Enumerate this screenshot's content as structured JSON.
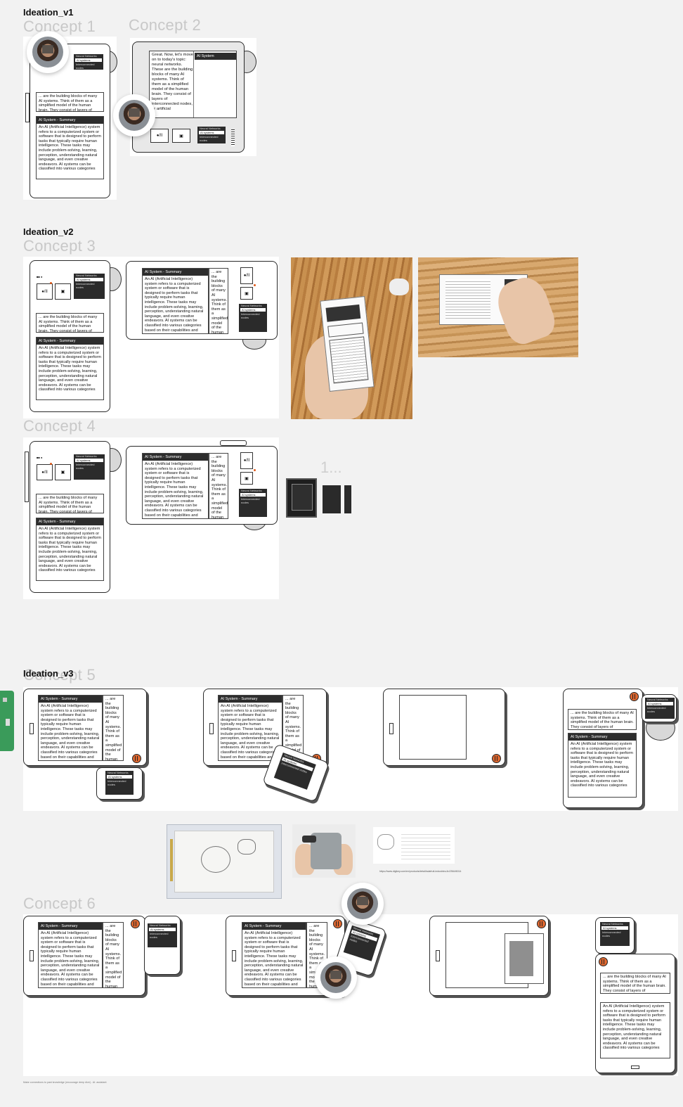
{
  "sections": {
    "v1": "Ideation_v1",
    "v2": "Ideation_v2",
    "v3": "Ideation_v3"
  },
  "concepts": {
    "c1": "Concept 1",
    "c2": "Concept 2",
    "c3": "Concept 3",
    "c4": "Concept 4",
    "c5": "Concept 5",
    "c6": "Concept 6"
  },
  "ui": {
    "reading_snippet": "... are the building blocks of many AI systems. Think of them as a simplified model of the human brain. They consist of layers of",
    "reading_col": "... are the building blocks of many AI systems. Think of them as a simplified model of the human brain. They consist of",
    "summary_title": "AI System - Summary",
    "summary_body": "An AI (Artificial Intelligence) system refers to a computerized system or software that is designed to perform tasks that typically require human intelligence. These tasks may include problem-solving, learning, perception, understanding natural language, and even creative endeavors. AI systems can be classified into various categories",
    "summary_body_long": "An AI (Artificial Intelligence) system refers to a computerized system or software that is designed to perform tasks that typically require human intelligence. These tasks may include problem-solving, learning, perception, understanding natural language, and even creative endeavors. AI systems can be classified into various categories based on their capabilities and",
    "concept2_text": "Great. Now, let's move on to today's topic: neural networks. These are the building blocks of many AI systems. Think of them as a simplified model of the human brain. They consist of layers of interconnected nodes, or artificial",
    "concept2_header": "AI System",
    "neural_title": "Neural Networks",
    "neural_item1": "AI systems",
    "neural_item2": "Interconnected nodes",
    "play_label": "●/II",
    "grid_label": "▣",
    "placeholder_count": "1...",
    "url_text": "https://www.digikey.com/en/products/detail/adafruit-industries-llc/2564/6014",
    "footnote": "Make connections to past knowledge (encourage deep dive) - AI: assistant"
  },
  "colors": {
    "accent": "#e06830",
    "frame": "#2a2a2a",
    "concept_label": "#c8c8c8",
    "canvas": "#f2f2f2"
  }
}
